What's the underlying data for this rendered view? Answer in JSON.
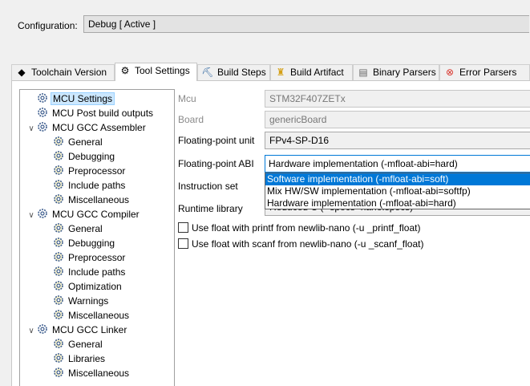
{
  "configuration": {
    "label": "Configuration:",
    "value": "Debug  [ Active ]"
  },
  "tabs": [
    {
      "label": "Toolchain Version",
      "icon": "chip-icon"
    },
    {
      "label": "Tool Settings",
      "icon": "gear-icon",
      "active": true
    },
    {
      "label": "Build Steps",
      "icon": "build-steps-icon"
    },
    {
      "label": "Build Artifact",
      "icon": "trophy-icon"
    },
    {
      "label": "Binary Parsers",
      "icon": "binary-icon"
    },
    {
      "label": "Error Parsers",
      "icon": "error-icon"
    }
  ],
  "tree": {
    "mcu_settings": "MCU Settings",
    "mcu_post_build": "MCU Post build outputs",
    "assembler": {
      "label": "MCU GCC Assembler",
      "children": [
        "General",
        "Debugging",
        "Preprocessor",
        "Include paths",
        "Miscellaneous"
      ]
    },
    "compiler": {
      "label": "MCU GCC Compiler",
      "children": [
        "General",
        "Debugging",
        "Preprocessor",
        "Include paths",
        "Optimization",
        "Warnings",
        "Miscellaneous"
      ]
    },
    "linker": {
      "label": "MCU GCC Linker",
      "children": [
        "General",
        "Libraries",
        "Miscellaneous"
      ]
    }
  },
  "form": {
    "mcu": {
      "label": "Mcu",
      "value": "STM32F407ZETx"
    },
    "board": {
      "label": "Board",
      "value": "genericBoard"
    },
    "fpu": {
      "label": "Floating-point unit",
      "value": "FPv4-SP-D16"
    },
    "fpabi": {
      "label": "Floating-point ABI",
      "value": "Hardware implementation (-mfloat-abi=hard)"
    },
    "instruction_set": {
      "label": "Instruction set"
    },
    "runtime_library": {
      "label": "Runtime library",
      "value": "Reduced C (--specs=nano.specs)"
    },
    "printf_float": {
      "label": "Use float with printf from newlib-nano (-u _printf_float)",
      "checked": false
    },
    "scanf_float": {
      "label": "Use float with scanf from newlib-nano (-u _scanf_float)",
      "checked": false
    }
  },
  "dropdown_options": [
    "Software implementation (-mfloat-abi=soft)",
    "Mix HW/SW implementation (-mfloat-abi=softfp)",
    "Hardware implementation (-mfloat-abi=hard)"
  ],
  "colors": {
    "selection": "#0078d7",
    "tree_selection": "#cce8ff"
  }
}
